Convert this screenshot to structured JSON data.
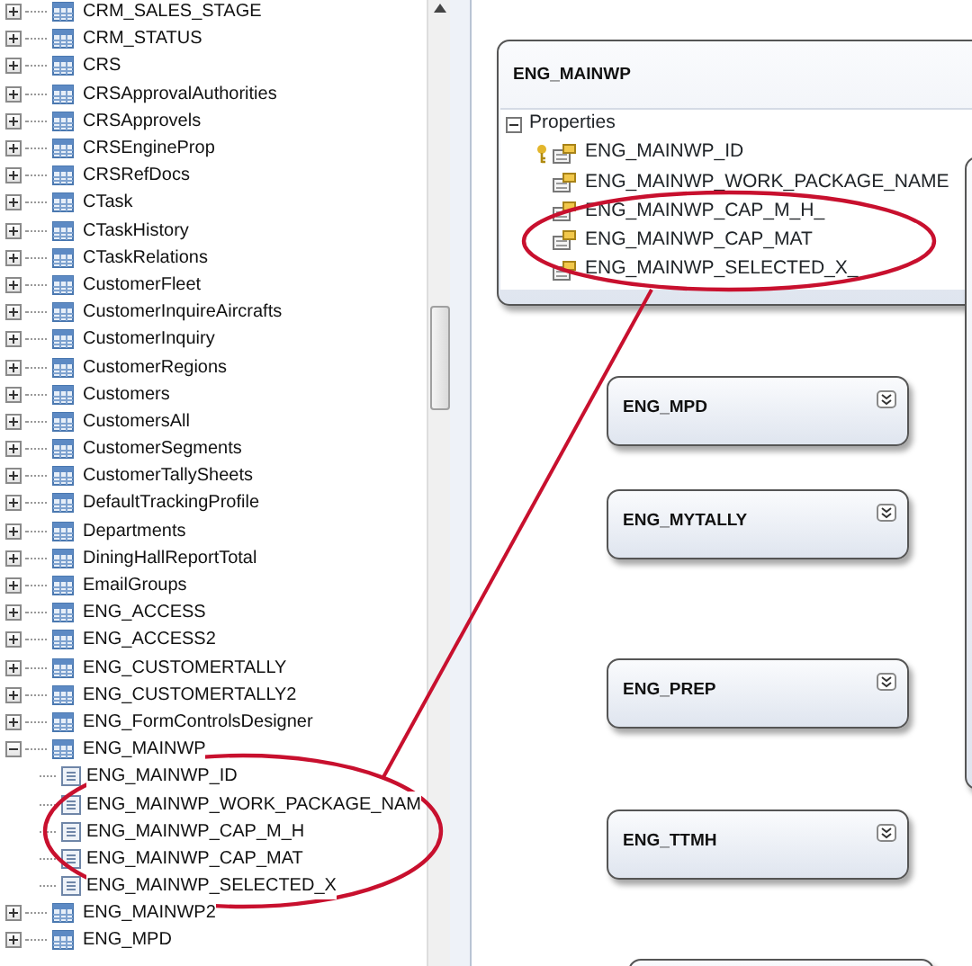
{
  "tree": {
    "items": [
      {
        "label": "CRM_SALES_STAGE",
        "kind": "table",
        "expanded": false
      },
      {
        "label": "CRM_STATUS",
        "kind": "table",
        "expanded": false
      },
      {
        "label": "CRS",
        "kind": "table",
        "expanded": false
      },
      {
        "label": "CRSApprovalAuthorities",
        "kind": "table",
        "expanded": false
      },
      {
        "label": "CRSApprovels",
        "kind": "table",
        "expanded": false
      },
      {
        "label": "CRSEngineProp",
        "kind": "table",
        "expanded": false
      },
      {
        "label": "CRSRefDocs",
        "kind": "table",
        "expanded": false
      },
      {
        "label": "CTask",
        "kind": "table",
        "expanded": false
      },
      {
        "label": "CTaskHistory",
        "kind": "table",
        "expanded": false
      },
      {
        "label": "CTaskRelations",
        "kind": "table",
        "expanded": false
      },
      {
        "label": "CustomerFleet",
        "kind": "table",
        "expanded": false
      },
      {
        "label": "CustomerInquireAircrafts",
        "kind": "table",
        "expanded": false
      },
      {
        "label": "CustomerInquiry",
        "kind": "table",
        "expanded": false
      },
      {
        "label": "CustomerRegions",
        "kind": "table",
        "expanded": false
      },
      {
        "label": "Customers",
        "kind": "table",
        "expanded": false
      },
      {
        "label": "CustomersAll",
        "kind": "table",
        "expanded": false
      },
      {
        "label": "CustomerSegments",
        "kind": "table",
        "expanded": false
      },
      {
        "label": "CustomerTallySheets",
        "kind": "table",
        "expanded": false
      },
      {
        "label": "DefaultTrackingProfile",
        "kind": "table",
        "expanded": false
      },
      {
        "label": "Departments",
        "kind": "table",
        "expanded": false
      },
      {
        "label": "DiningHallReportTotal",
        "kind": "table",
        "expanded": false
      },
      {
        "label": "EmailGroups",
        "kind": "table",
        "expanded": false
      },
      {
        "label": "ENG_ACCESS",
        "kind": "table",
        "expanded": false
      },
      {
        "label": "ENG_ACCESS2",
        "kind": "table",
        "expanded": false
      },
      {
        "label": "ENG_CUSTOMERTALLY",
        "kind": "table",
        "expanded": false
      },
      {
        "label": "ENG_CUSTOMERTALLY2",
        "kind": "table",
        "expanded": false
      },
      {
        "label": "ENG_FormControlsDesigner",
        "kind": "table",
        "expanded": false
      },
      {
        "label": "ENG_MAINWP",
        "kind": "table",
        "expanded": true,
        "children": [
          {
            "label": "ENG_MAINWP_ID",
            "kind": "column"
          },
          {
            "label": "ENG_MAINWP_WORK_PACKAGE_NAM",
            "kind": "column"
          },
          {
            "label": "ENG_MAINWP_CAP_M_H",
            "kind": "column"
          },
          {
            "label": "ENG_MAINWP_CAP_MAT",
            "kind": "column"
          },
          {
            "label": "ENG_MAINWP_SELECTED_X",
            "kind": "column"
          }
        ]
      },
      {
        "label": "ENG_MAINWP2",
        "kind": "table",
        "expanded": false
      },
      {
        "label": "ENG_MPD",
        "kind": "table",
        "expanded": false
      }
    ]
  },
  "diagram": {
    "entities": [
      {
        "title": "ENG_MAINWP",
        "expanded": true,
        "section": "Properties",
        "section_expanded": true,
        "properties": [
          {
            "name": "ENG_MAINWP_ID",
            "key": true
          },
          {
            "name": "ENG_MAINWP_WORK_PACKAGE_NAME",
            "key": false
          },
          {
            "name": "ENG_MAINWP_CAP_M_H_",
            "key": false
          },
          {
            "name": "ENG_MAINWP_CAP_MAT",
            "key": false
          },
          {
            "name": "ENG_MAINWP_SELECTED_X_",
            "key": false
          }
        ]
      },
      {
        "title": "ENG_MPD",
        "expanded": false
      },
      {
        "title": "ENG_MYTALLY",
        "expanded": false
      },
      {
        "title": "ENG_PREP",
        "expanded": false
      },
      {
        "title": "ENG_TTMH",
        "expanded": false
      }
    ]
  }
}
